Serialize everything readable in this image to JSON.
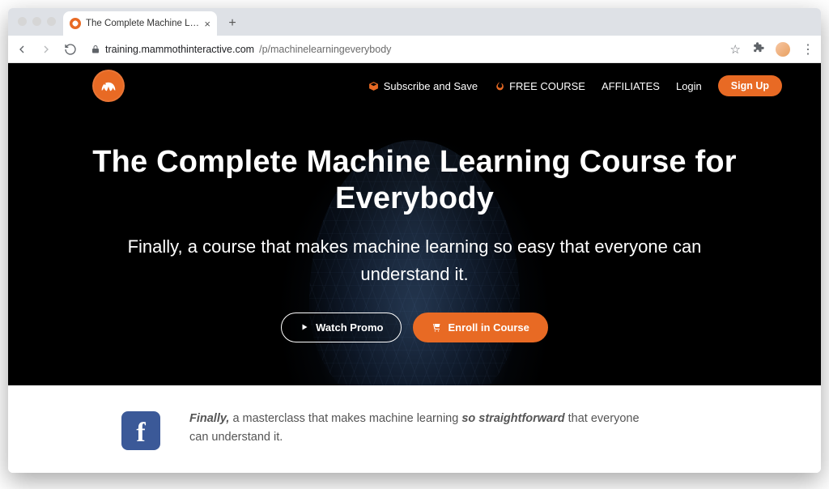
{
  "browser": {
    "tab_title": "The Complete Machine Learnin",
    "url_domain": "training.mammothinteractive.com",
    "url_path": "/p/machinelearningeverybody"
  },
  "nav": {
    "subscribe": "Subscribe and Save",
    "free_course": "FREE COURSE",
    "affiliates": "AFFILIATES",
    "login": "Login",
    "signup": "Sign Up"
  },
  "hero": {
    "title": "The Complete Machine Learning Course for Everybody",
    "subtitle": "Finally, a course that makes machine learning so easy that everyone can understand it.",
    "watch_promo": "Watch Promo",
    "enroll": "Enroll in Course"
  },
  "desc": {
    "lead": "Finally,",
    "mid1": " a masterclass that makes machine learning ",
    "emph": "so straightforward",
    "mid2": " that everyone can understand it."
  },
  "colors": {
    "accent": "#e86a24",
    "facebook": "#3b5998"
  }
}
